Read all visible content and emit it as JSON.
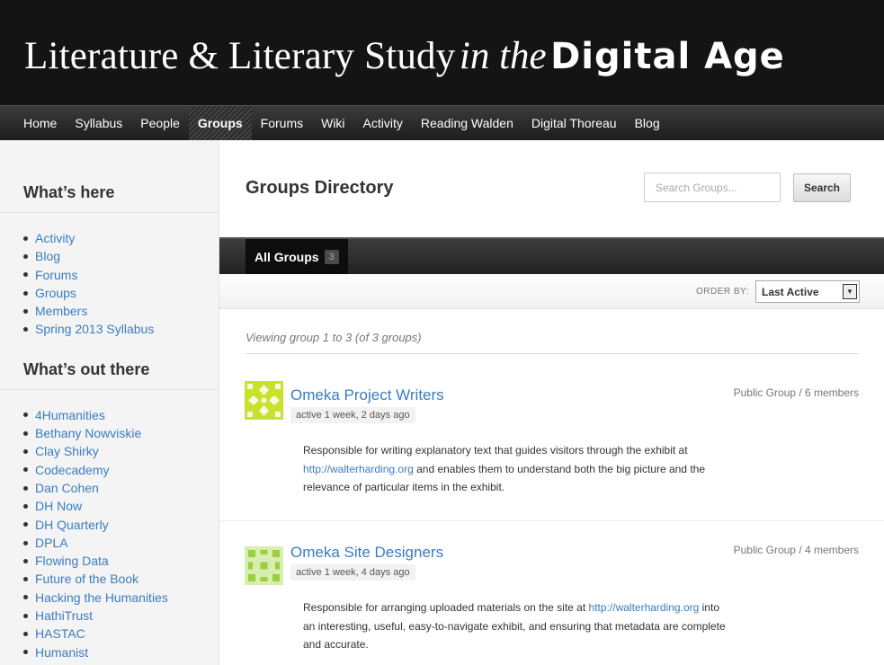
{
  "site": {
    "title_part1": "Literature & Literary Study",
    "title_part2": "in the",
    "title_part3": "Digital Age"
  },
  "nav": [
    "Home",
    "Syllabus",
    "People",
    "Groups",
    "Forums",
    "Wiki",
    "Activity",
    "Reading Walden",
    "Digital Thoreau",
    "Blog"
  ],
  "nav_active": "Groups",
  "sidebar": {
    "widget1_title": "What’s here",
    "widget1_items": [
      "Activity",
      "Blog",
      "Forums",
      "Groups",
      "Members",
      "Spring 2013 Syllabus"
    ],
    "widget2_title": "What’s out there",
    "widget2_items": [
      "4Humanities",
      "Bethany Nowviskie",
      "Clay Shirky",
      "Codecademy",
      "Dan Cohen",
      "DH Now",
      "DH Quarterly",
      "DPLA",
      "Flowing Data",
      "Future of the Book",
      "Hacking the Humanities",
      "HathiTrust",
      "HASTAC",
      "Humanist"
    ]
  },
  "main": {
    "title": "Groups Directory",
    "search_placeholder": "Search Groups...",
    "search_button": "Search",
    "tab_label": "All Groups",
    "tab_count": "3",
    "order_by_label": "ORDER BY:",
    "order_by_value": "Last Active",
    "viewing_text": "Viewing group 1 to 3 (of 3 groups)"
  },
  "groups": [
    {
      "name": "Omeka Project Writers",
      "active": "active 1 week, 2 days ago",
      "meta": "Public Group / 6 members",
      "desc_before": "Responsible for writing explanatory text that guides visitors through the exhibit at",
      "desc_link": "http://walterharding.org",
      "desc_after": "and enables them to understand both the big picture and the relevance of particular items in the exhibit."
    },
    {
      "name": "Omeka Site Designers",
      "active": "active 1 week, 4 days ago",
      "meta": "Public Group / 4 members",
      "desc_before": "Responsible for arranging uploaded materials on the site at",
      "desc_link": "http://walterharding.org",
      "desc_after": "into an interesting, useful, easy-to-navigate exhibit, and ensuring that metadata are complete and accurate."
    }
  ]
}
